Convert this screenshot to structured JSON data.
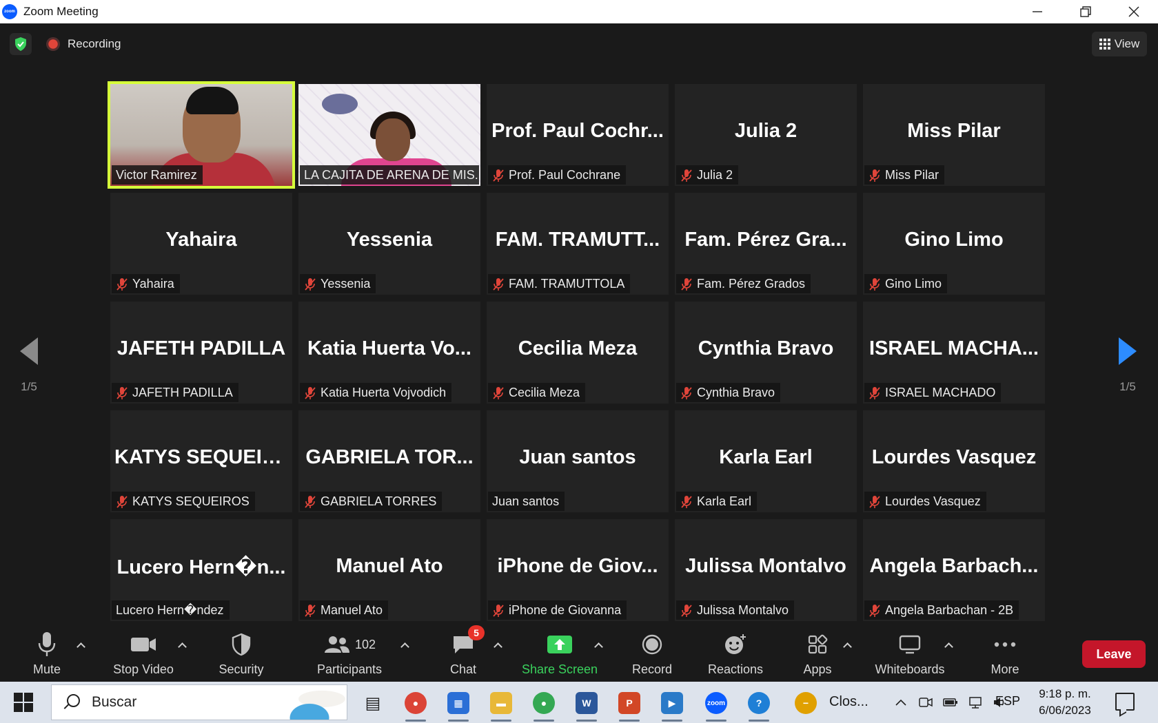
{
  "window": {
    "title": "Zoom Meeting",
    "logo_text": "zoom"
  },
  "topbar": {
    "recording_label": "Recording",
    "view_label": "View"
  },
  "pager": {
    "left_page": "1/5",
    "right_page": "1/5"
  },
  "tiles": [
    {
      "big": "",
      "label": "Victor Ramirez",
      "muted": false,
      "video": "victor",
      "speaking": true
    },
    {
      "big": "",
      "label": "LA CAJITA DE ARENA DE MIS...",
      "muted": false,
      "video": "lacajita",
      "speaking": false
    },
    {
      "big": "Prof. Paul Cochr...",
      "label": "Prof. Paul Cochrane",
      "muted": true
    },
    {
      "big": "Julia 2",
      "label": "Julia 2",
      "muted": true
    },
    {
      "big": "Miss Pilar",
      "label": "Miss Pilar",
      "muted": true
    },
    {
      "big": "Yahaira",
      "label": "Yahaira",
      "muted": true
    },
    {
      "big": "Yessenia",
      "label": "Yessenia",
      "muted": true
    },
    {
      "big": "FAM. TRAMUTT...",
      "label": "FAM. TRAMUTTOLA",
      "muted": true
    },
    {
      "big": "Fam. Pérez Gra...",
      "label": "Fam. Pérez Grados",
      "muted": true
    },
    {
      "big": "Gino Limo",
      "label": "Gino Limo",
      "muted": true
    },
    {
      "big": "JAFETH PADILLA",
      "label": "JAFETH PADILLA",
      "muted": true
    },
    {
      "big": "Katia Huerta Vo...",
      "label": "Katia Huerta Vojvodich",
      "muted": true
    },
    {
      "big": "Cecilia Meza",
      "label": "Cecilia Meza",
      "muted": true
    },
    {
      "big": "Cynthia Bravo",
      "label": "Cynthia Bravo",
      "muted": true
    },
    {
      "big": "ISRAEL MACHA...",
      "label": "ISRAEL MACHADO",
      "muted": true
    },
    {
      "big": "KATYS SEQUEIR...",
      "label": "KATYS SEQUEIROS",
      "muted": true
    },
    {
      "big": "GABRIELA TOR...",
      "label": "GABRIELA TORRES",
      "muted": true
    },
    {
      "big": "Juan santos",
      "label": "Juan santos",
      "muted": false
    },
    {
      "big": "Karla Earl",
      "label": "Karla Earl",
      "muted": true
    },
    {
      "big": "Lourdes Vasquez",
      "label": "Lourdes Vasquez",
      "muted": true
    },
    {
      "big": "Lucero Hern�n...",
      "label": "Lucero Hern�ndez",
      "muted": false
    },
    {
      "big": "Manuel Ato",
      "label": "Manuel Ato",
      "muted": true
    },
    {
      "big": "iPhone de Giov...",
      "label": "iPhone de Giovanna",
      "muted": true
    },
    {
      "big": "Julissa Montalvo",
      "label": "Julissa Montalvo",
      "muted": true
    },
    {
      "big": "Angela Barbach...",
      "label": "Angela Barbachan - 2B",
      "muted": true
    }
  ],
  "toolbar": {
    "mute": "Mute",
    "stop_video": "Stop Video",
    "security": "Security",
    "participants": "Participants",
    "participants_count": "102",
    "chat": "Chat",
    "chat_badge": "5",
    "share_screen": "Share Screen",
    "record": "Record",
    "reactions": "Reactions",
    "apps": "Apps",
    "whiteboards": "Whiteboards",
    "more": "More",
    "leave": "Leave"
  },
  "taskbar": {
    "search_placeholder": "Buscar",
    "closed_app_label": "Clos...",
    "language": "ESP",
    "time": "9:18 p. m.",
    "date": "6/06/2023",
    "apps": [
      {
        "name": "task-view-icon",
        "color": "#3a3a3a",
        "glyph": "▤"
      },
      {
        "name": "chrome-icon",
        "color": "#db4437",
        "glyph": "●"
      },
      {
        "name": "store-icon",
        "color": "#2b6fd6",
        "glyph": "▦"
      },
      {
        "name": "file-explorer-icon",
        "color": "#e8b838",
        "glyph": "▬"
      },
      {
        "name": "chrome-profile-icon",
        "color": "#34a853",
        "glyph": "●"
      },
      {
        "name": "word-icon",
        "color": "#2b579a",
        "glyph": "W"
      },
      {
        "name": "powerpoint-icon",
        "color": "#d24726",
        "glyph": "P"
      },
      {
        "name": "media-player-icon",
        "color": "#2a7ac8",
        "glyph": "▶"
      },
      {
        "name": "zoom-icon",
        "color": "#0b5cff",
        "glyph": "zoom"
      },
      {
        "name": "help-icon",
        "color": "#1f7fd6",
        "glyph": "?"
      },
      {
        "name": "closed-app-icon",
        "color": "#e0a000",
        "glyph": "−"
      }
    ]
  },
  "colors": {
    "speaking_border": "#d6ff3a",
    "share_green": "#3ad25d",
    "leave_red": "#c4162a",
    "badge_red": "#e8322a",
    "pager_blue": "#2d8cff"
  }
}
